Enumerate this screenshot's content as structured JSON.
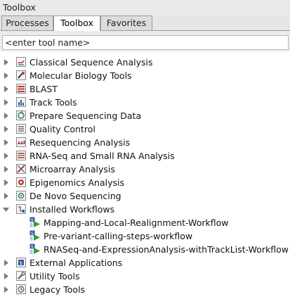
{
  "panel": {
    "title": "Toolbox"
  },
  "tabs": [
    {
      "label": "Processes"
    },
    {
      "label": "Toolbox"
    },
    {
      "label": "Favorites"
    }
  ],
  "search": {
    "placeholder": "<enter tool name>"
  },
  "tree": {
    "items": [
      {
        "label": "Classical Sequence Analysis",
        "icon": "classical-sequence-icon",
        "expanded": false
      },
      {
        "label": "Molecular Biology Tools",
        "icon": "molecular-biology-icon",
        "expanded": false
      },
      {
        "label": "BLAST",
        "icon": "blast-icon",
        "expanded": false
      },
      {
        "label": "Track Tools",
        "icon": "track-tools-icon",
        "expanded": false
      },
      {
        "label": "Prepare Sequencing Data",
        "icon": "prepare-data-icon",
        "expanded": false
      },
      {
        "label": "Quality Control",
        "icon": "quality-control-icon",
        "expanded": false
      },
      {
        "label": "Resequencing Analysis",
        "icon": "resequencing-icon",
        "expanded": false
      },
      {
        "label": "RNA-Seq and Small RNA Analysis",
        "icon": "rna-seq-icon",
        "expanded": false
      },
      {
        "label": "Microarray Analysis",
        "icon": "microarray-icon",
        "expanded": false
      },
      {
        "label": "Epigenomics Analysis",
        "icon": "epigenomics-icon",
        "expanded": false
      },
      {
        "label": "De Novo Sequencing",
        "icon": "de-novo-icon",
        "expanded": false
      },
      {
        "label": "Installed Workflows",
        "icon": "workflows-folder-icon",
        "expanded": true,
        "children": [
          {
            "label": "Mapping-and-Local-Realignment-Workflow",
            "icon": "workflow-icon"
          },
          {
            "label": "Pre-variant-calling-steps-workflow",
            "icon": "workflow-icon"
          },
          {
            "label": "RNASeq-and-ExpressionAnalysis-withTrackList-Workflow",
            "icon": "workflow-icon"
          }
        ]
      },
      {
        "label": "External Applications",
        "icon": "external-apps-icon",
        "expanded": false
      },
      {
        "label": "Utility Tools",
        "icon": "utility-tools-icon",
        "expanded": false
      },
      {
        "label": "Legacy Tools",
        "icon": "legacy-tools-icon",
        "expanded": false
      }
    ]
  },
  "colors": {
    "tree_background": "#ffffff",
    "panel_background": "#ececec",
    "active_tab": "#ffffff",
    "inactive_tab": "#dcdcdc"
  }
}
